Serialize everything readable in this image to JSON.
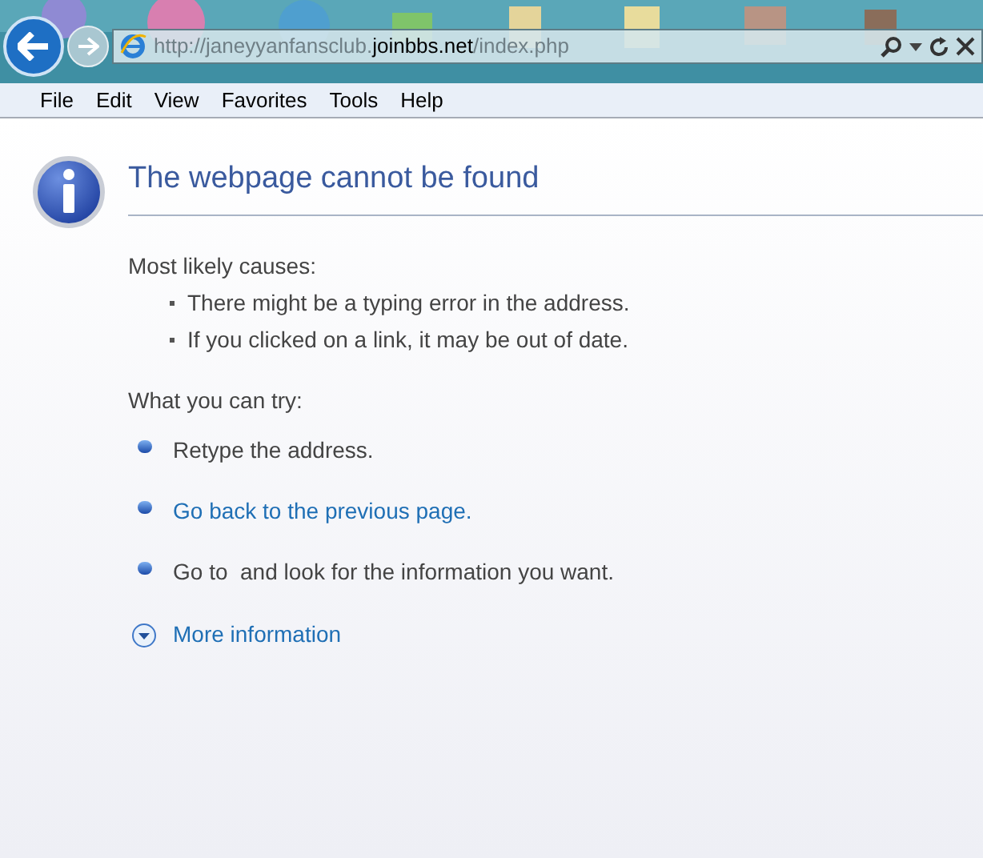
{
  "toolbar": {
    "address": {
      "prefix": "http://janeyyanfansclub.",
      "domain": "joinbbs.net",
      "suffix": "/index.php"
    }
  },
  "menu": [
    "File",
    "Edit",
    "View",
    "Favorites",
    "Tools",
    "Help"
  ],
  "page": {
    "title": "The webpage cannot be found",
    "causes_heading": "Most likely causes:",
    "causes": [
      "There might be a typing error in the address.",
      "If you clicked on a link, it may be out of date."
    ],
    "try_heading": "What you can try:",
    "try_items": [
      {
        "kind": "text",
        "text": "Retype the address."
      },
      {
        "kind": "link",
        "text": "Go back to the previous page."
      },
      {
        "kind": "text",
        "text": "Go to  and look for the information you want."
      }
    ],
    "more_info": "More information"
  }
}
